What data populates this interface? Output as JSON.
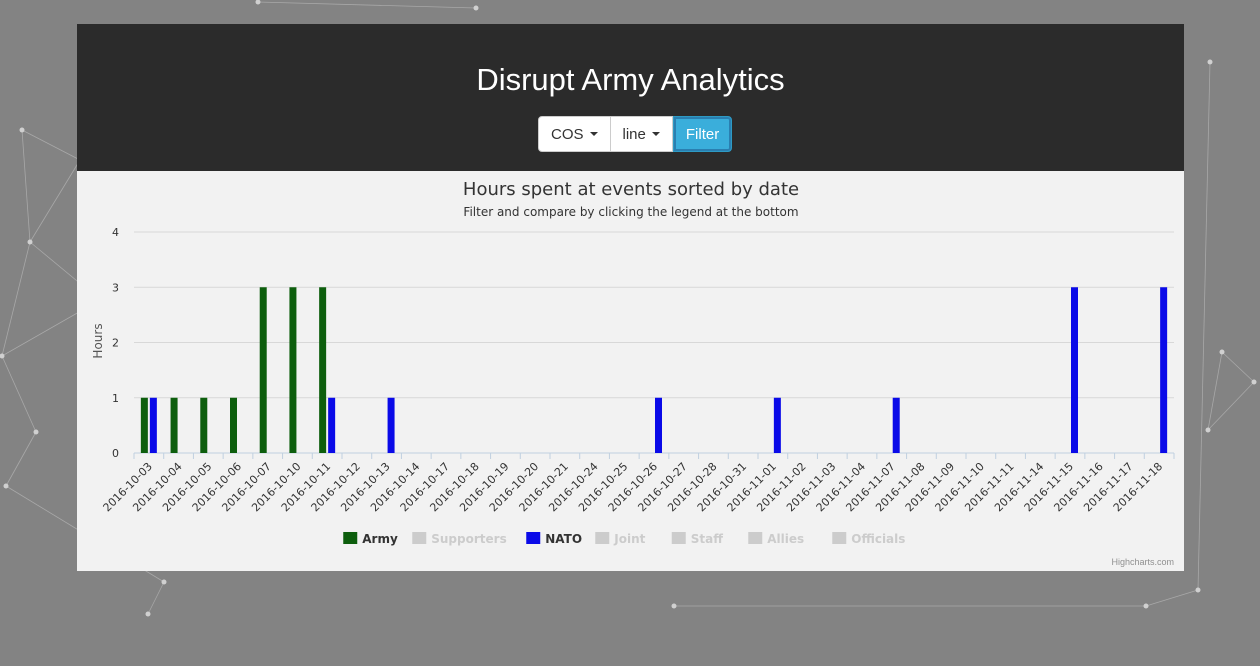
{
  "app": {
    "title": "Disrupt Army Analytics",
    "dropdown_category": "COS",
    "dropdown_type": "line",
    "filter_label": "Filter"
  },
  "credits": "Highcharts.com",
  "chart_data": {
    "type": "bar",
    "title": "Hours spent at events sorted by date",
    "subtitle": "Filter and compare by clicking the legend at the bottom",
    "ylabel": "Hours",
    "xlabel": "",
    "ylim": [
      0,
      4
    ],
    "yticks": [
      0,
      1,
      2,
      3,
      4
    ],
    "grid": true,
    "legend_position": "bottom",
    "categories": [
      "2016-10-03",
      "2016-10-04",
      "2016-10-05",
      "2016-10-06",
      "2016-10-07",
      "2016-10-10",
      "2016-10-11",
      "2016-10-12",
      "2016-10-13",
      "2016-10-14",
      "2016-10-17",
      "2016-10-18",
      "2016-10-19",
      "2016-10-20",
      "2016-10-21",
      "2016-10-24",
      "2016-10-25",
      "2016-10-26",
      "2016-10-27",
      "2016-10-28",
      "2016-10-31",
      "2016-11-01",
      "2016-11-02",
      "2016-11-03",
      "2016-11-04",
      "2016-11-07",
      "2016-11-08",
      "2016-11-09",
      "2016-11-10",
      "2016-11-11",
      "2016-11-14",
      "2016-11-15",
      "2016-11-16",
      "2016-11-17",
      "2016-11-18"
    ],
    "series": [
      {
        "name": "Army",
        "color": "#0d5e0d",
        "visible": true,
        "values": [
          1,
          1,
          1,
          1,
          3,
          3,
          3,
          0,
          0,
          0,
          0,
          0,
          0,
          0,
          0,
          0,
          0,
          0,
          0,
          0,
          0,
          0,
          0,
          0,
          0,
          0,
          0,
          0,
          0,
          0,
          0,
          0,
          0,
          0,
          0
        ]
      },
      {
        "name": "Supporters",
        "color": "#cccccc",
        "visible": false,
        "values": []
      },
      {
        "name": "NATO",
        "color": "#0a0ae8",
        "visible": true,
        "values": [
          1,
          0,
          0,
          0,
          0,
          0,
          1,
          0,
          1,
          0,
          0,
          0,
          0,
          0,
          0,
          0,
          0,
          1,
          0,
          0,
          0,
          1,
          0,
          0,
          0,
          1,
          0,
          0,
          0,
          0,
          0,
          3,
          0,
          0,
          3
        ]
      },
      {
        "name": "Joint",
        "color": "#cccccc",
        "visible": false,
        "values": []
      },
      {
        "name": "Staff",
        "color": "#cccccc",
        "visible": false,
        "values": []
      },
      {
        "name": "Allies",
        "color": "#cccccc",
        "visible": false,
        "values": []
      },
      {
        "name": "Officials",
        "color": "#cccccc",
        "visible": false,
        "values": []
      }
    ]
  }
}
